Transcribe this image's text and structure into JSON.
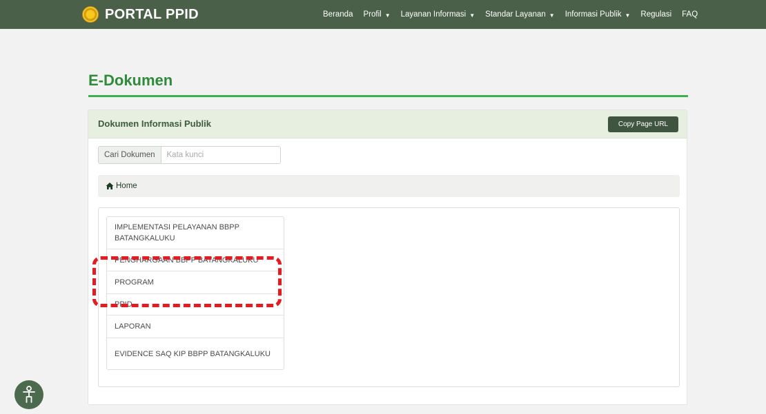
{
  "navbar": {
    "brand": "PORTAL PPID",
    "items": [
      {
        "label": "Beranda",
        "dropdown": false
      },
      {
        "label": "Profil",
        "dropdown": true
      },
      {
        "label": "Layanan Informasi",
        "dropdown": true
      },
      {
        "label": "Standar Layanan",
        "dropdown": true
      },
      {
        "label": "Informasi Publik",
        "dropdown": true
      },
      {
        "label": "Regulasi",
        "dropdown": false
      },
      {
        "label": "FAQ",
        "dropdown": false
      }
    ]
  },
  "page": {
    "title": "E-Dokumen"
  },
  "panel": {
    "title": "Dokumen Informasi Publik",
    "copy_button": "Copy Page URL",
    "search_label": "Cari Dokumen",
    "search_placeholder": "Kata kunci",
    "search_value": "",
    "breadcrumb": "Home",
    "folders": [
      "IMPLEMENTASI PELAYANAN BBPP BATANGKALUKU",
      "PENGHARGAAN BBPP BATANGKALUKU",
      "PROGRAM",
      "PPID",
      "LAPORAN",
      "EVIDENCE SAQ KIP BBPP BATANGKALUKU"
    ]
  },
  "icons": {
    "brand_logo": "emblem-logo-icon",
    "breadcrumb": "home-icon",
    "accessibility": "accessibility-icon",
    "nav_caret": "caret-down-icon"
  },
  "colors": {
    "navbar_bg": "#4a6048",
    "title_green": "#2f8a3b",
    "rule_green": "#3fae4c",
    "panel_head_bg": "#e6efe0",
    "button_bg": "#3f5540",
    "highlight_red": "#e31b23"
  }
}
